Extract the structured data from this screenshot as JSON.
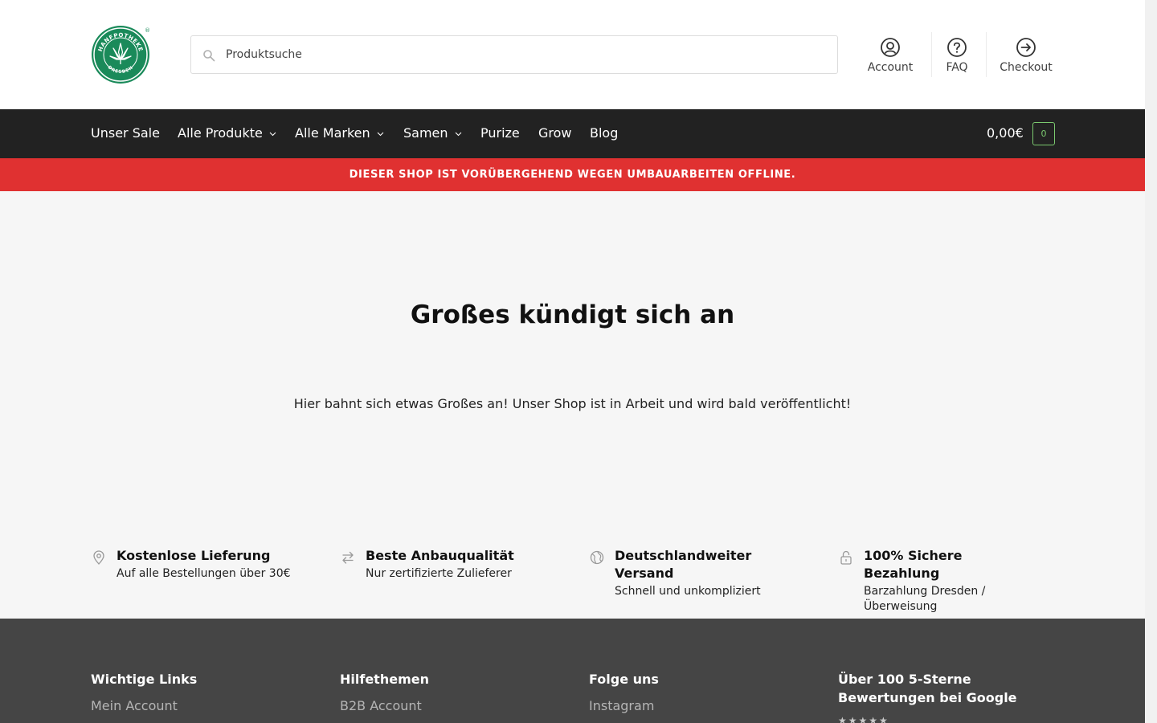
{
  "search": {
    "placeholder": "Produktsuche"
  },
  "header_links": {
    "account": "Account",
    "faq": "FAQ",
    "checkout": "Checkout"
  },
  "logo": {
    "top_text": "HANFPOTHEKE",
    "bottom_text": "DRESDEN",
    "mark": "®",
    "color": "#1a8a5a"
  },
  "nav": {
    "items": [
      {
        "label": "Unser Sale"
      },
      {
        "label": "Alle Produkte"
      },
      {
        "label": "Alle Marken"
      },
      {
        "label": "Samen"
      },
      {
        "label": "Purize"
      },
      {
        "label": "Grow"
      },
      {
        "label": "Blog"
      }
    ],
    "cart_total": "0,00€",
    "cart_count": "0"
  },
  "notice": {
    "text": "DIESER SHOP IST VORÜBERGEHEND WEGEN UMBAUARBEITEN OFFLINE."
  },
  "main": {
    "headline": "Großes kündigt sich an",
    "subline": "Hier bahnt sich etwas Großes an! Unser Shop ist in Arbeit und wird bald veröffentlicht!"
  },
  "features": [
    {
      "icon": "location-pin-icon",
      "title": "Kostenlose Lieferung",
      "subtitle": "Auf alle Bestellungen über 30€"
    },
    {
      "icon": "arrows-exchange-icon",
      "title": "Beste Anbauqualität",
      "subtitle": "Nur zertifizierte Zulieferer"
    },
    {
      "icon": "globe-icon",
      "title": "Deutschlandweiter Versand",
      "subtitle": "Schnell und unkompliziert"
    },
    {
      "icon": "lock-icon",
      "title": "100% Sichere Bezahlung",
      "subtitle": "Barzahlung Dresden / Überweisung"
    }
  ],
  "footer": {
    "columns": [
      {
        "heading": "Wichtige Links",
        "first_link": "Mein Account"
      },
      {
        "heading": "Hilfethemen",
        "first_link": "B2B Account"
      },
      {
        "heading": "Folge uns",
        "first_link": "Instagram"
      },
      {
        "heading": "Über 100 5-Sterne Bewertungen bei Google"
      }
    ]
  },
  "colors": {
    "nav_bg": "#222222",
    "notice_bg": "#e03131",
    "cart_accent": "#7bc96f",
    "footer_bg": "#454545"
  }
}
